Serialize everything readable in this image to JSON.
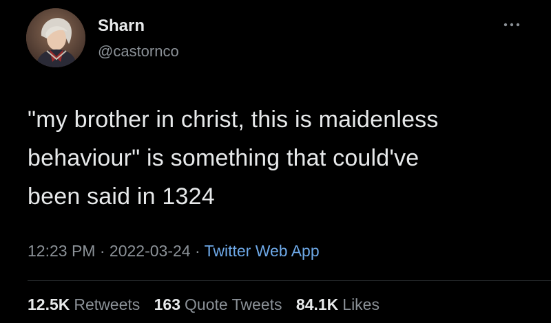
{
  "user": {
    "name": "Sharn",
    "handle": "@castornco",
    "avatar": "anime-character-avatar"
  },
  "more_icon": "more-horizontal-icon",
  "tweet": {
    "text": "\"my brother in christ, this is maidenless\nbehaviour\" is something that could've\nbeen said in 1324"
  },
  "meta": {
    "time": "12:23 PM",
    "separator": " · ",
    "date": "2022-03-24",
    "source": "Twitter Web App"
  },
  "stats": {
    "retweets": {
      "count": "12.5K",
      "label": "Retweets"
    },
    "quotes": {
      "count": "163",
      "label": "Quote Tweets"
    },
    "likes": {
      "count": "84.1K",
      "label": "Likes"
    }
  },
  "colors": {
    "background": "#000000",
    "text": "#e7e9ea",
    "secondary": "#8b9197",
    "link": "#6ea9e8"
  }
}
